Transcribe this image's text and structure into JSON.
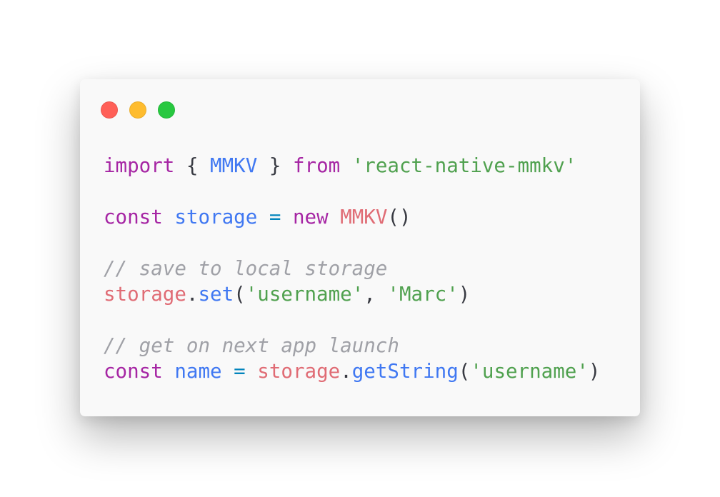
{
  "colors": {
    "red_dot": "#ff5f57",
    "yellow_dot": "#febc2e",
    "green_dot": "#28c840"
  },
  "code": {
    "line1": {
      "kw_import": "import",
      "brace_open": "{",
      "ident_mmkv": "MMKV",
      "brace_close": "}",
      "kw_from": "from",
      "str_module": "'react-native-mmkv'"
    },
    "line3": {
      "kw_const": "const",
      "ident_storage": "storage",
      "op_eq": "=",
      "kw_new": "new",
      "class_mmkv": "MMKV",
      "parens": "()"
    },
    "line5": {
      "comment": "// save to local storage"
    },
    "line6": {
      "var_storage": "storage",
      "dot": ".",
      "method_set": "set",
      "paren_open": "(",
      "str_key": "'username'",
      "comma": ",",
      "str_value": "'Marc'",
      "paren_close": ")"
    },
    "line8": {
      "comment": "// get on next app launch"
    },
    "line9": {
      "kw_const": "const",
      "ident_name": "name",
      "op_eq": "=",
      "var_storage": "storage",
      "dot": ".",
      "method_get": "getString",
      "paren_open": "(",
      "str_key": "'username'",
      "paren_close": ")"
    }
  }
}
